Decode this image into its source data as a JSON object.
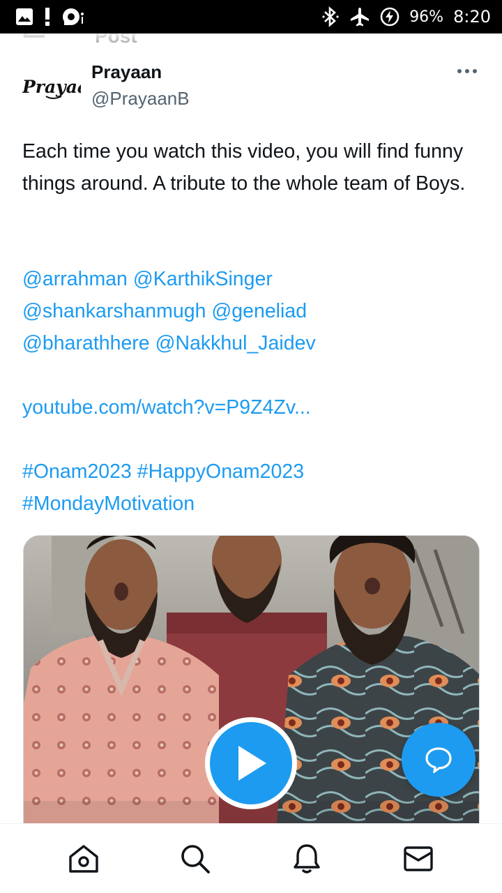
{
  "status_bar": {
    "battery_percent": "96%",
    "time": "8:20",
    "icons": [
      "image-icon",
      "alert-icon",
      "cast-icon",
      "bluetooth-icon",
      "airplane-mode-icon",
      "battery-charging-icon"
    ]
  },
  "header": {
    "title": "Post",
    "back_icon": "back-arrow-icon"
  },
  "author": {
    "name": "Prayaan",
    "handle": "@PrayaanB",
    "avatar_text": "Prayaa"
  },
  "tweet": {
    "text": "Each time you  watch this video, you will find funny things around.  A tribute to the whole team of Boys.",
    "mentions_line1": [
      "@arrahman",
      "@KarthikSinger"
    ],
    "mentions_line2": [
      "@shankarshanmugh",
      "@geneliad"
    ],
    "mentions_line3": [
      "@bharathhere",
      "@Nakkhul_Jaidev"
    ],
    "link": "youtube.com/watch?v=P9Z4Zv...",
    "hashtags_line1": [
      "#Onam2023",
      "#HappyOnam2023"
    ],
    "hashtags_line2": [
      "#MondayMotivation"
    ]
  },
  "media": {
    "type": "video",
    "play_icon": "play-icon"
  },
  "fab": {
    "icon": "reply-bubble-icon"
  },
  "bottom_nav": {
    "items": [
      "home-icon",
      "search-icon",
      "notifications-icon",
      "messages-icon"
    ]
  },
  "colors": {
    "accent": "#1d9bf0",
    "text": "#0f1419",
    "secondary": "#536471"
  }
}
